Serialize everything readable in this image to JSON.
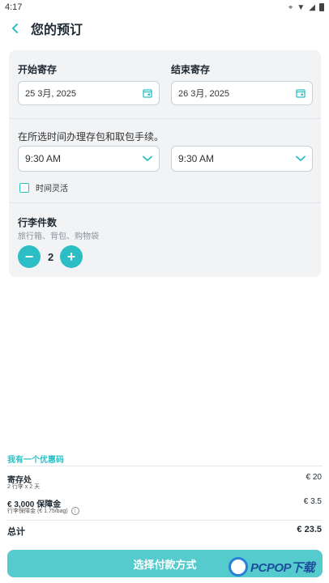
{
  "status_bar": {
    "time": "4:17"
  },
  "header": {
    "title": "您的预订"
  },
  "dates": {
    "start_label": "开始寄存",
    "end_label": "结束寄存",
    "start_value": "25 3月, 2025",
    "end_value": "26 3月, 2025"
  },
  "times": {
    "hint": "在所选时间办理存包和取包手续。",
    "start_time": "9:30 AM",
    "end_time": "9:30 AM",
    "flexible_label": "时间灵活",
    "flexible_checked": false
  },
  "bags": {
    "label": "行李件数",
    "sub": "旅行箱、背包、购物袋",
    "minus": "−",
    "plus": "+",
    "count": "2"
  },
  "summary": {
    "coupon": "我有一个优惠码",
    "storage_title": "寄存处",
    "storage_sub": "2 行李 x 2 天",
    "storage_price": "€ 20",
    "deposit_title": "€ 3,000 保障金",
    "deposit_sub": "行李保障金 (€ 1.75/bag)",
    "deposit_price": "€ 3.5",
    "total_label": "总计",
    "total_price": "€ 23.5"
  },
  "cta": {
    "label": "选择付款方式"
  },
  "watermark": {
    "text": "PCPOP下载"
  },
  "colors": {
    "accent": "#2bbfc5",
    "button": "#56cbce",
    "card": "#f1f3f5"
  }
}
